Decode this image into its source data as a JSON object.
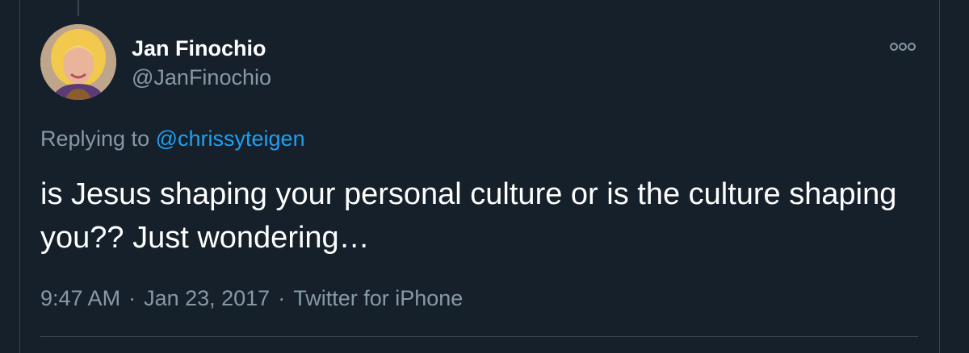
{
  "tweet": {
    "author_name": "Jan Finochio",
    "author_handle": "@JanFinochio",
    "replying_prefix": "Replying to",
    "replying_to": "@chrissyteigen",
    "text": "is Jesus shaping your personal culture or is the culture shaping you?? Just wondering…",
    "time": "9:47 AM",
    "separator": "·",
    "date": "Jan 23, 2017",
    "source": "Twitter for iPhone"
  },
  "icons": {
    "more": "more-options-icon",
    "avatar": "profile-photo"
  },
  "colors": {
    "background": "#15202b",
    "primary_text": "#ffffff",
    "secondary_text": "#8899a6",
    "link": "#1da1f2",
    "divider": "#38444d"
  }
}
